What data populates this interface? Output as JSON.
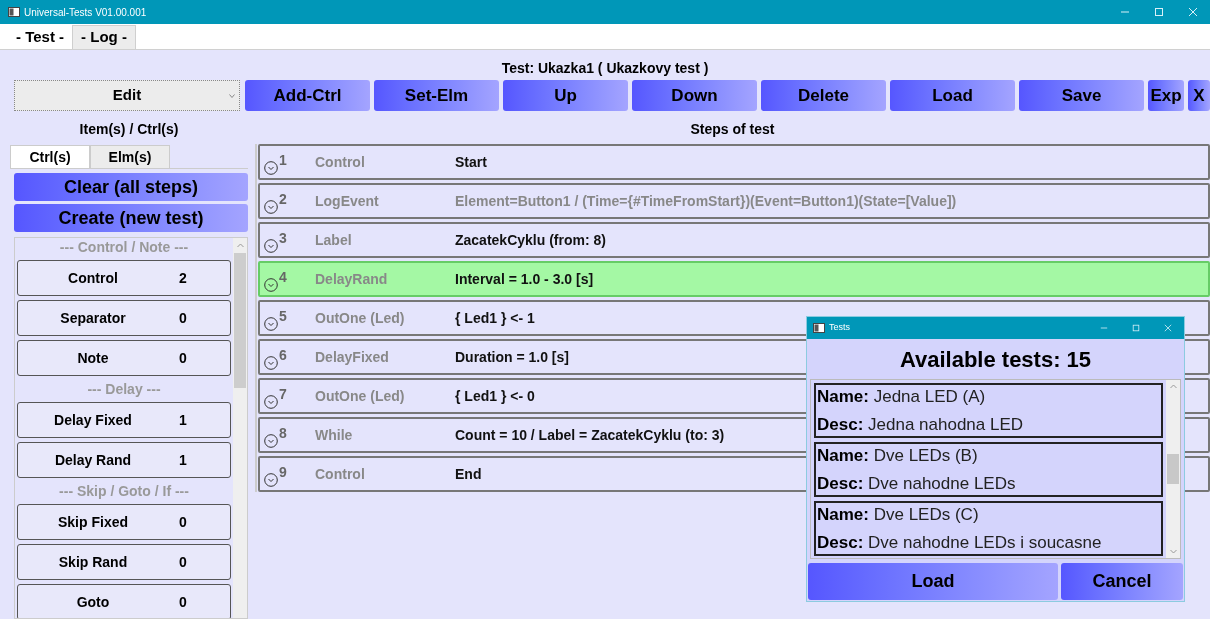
{
  "window": {
    "title": "Universal-Tests V01.00.001"
  },
  "main_tabs": [
    {
      "label": "- Test -",
      "selected": true
    },
    {
      "label": "- Log -",
      "selected": false
    }
  ],
  "test_title": "Test: Ukazka1 ( Ukazkovy test )",
  "mode_select": {
    "value": "Edit"
  },
  "toolbar": [
    "Add-Ctrl",
    "Set-Elm",
    "Up",
    "Down",
    "Delete",
    "Load",
    "Save",
    "Exp",
    "X"
  ],
  "sidebar": {
    "heading": "Item(s) / Ctrl(s)",
    "tabs": [
      {
        "label": "Ctrl(s)",
        "selected": true
      },
      {
        "label": "Elm(s)",
        "selected": false
      }
    ],
    "actions": [
      "Clear (all steps)",
      "Create (new test)"
    ],
    "items": [
      {
        "kind": "section",
        "label": "--- Control / Note ---"
      },
      {
        "kind": "item",
        "label": "Control",
        "count": "2"
      },
      {
        "kind": "item",
        "label": "Separator",
        "count": "0"
      },
      {
        "kind": "item",
        "label": "Note",
        "count": "0"
      },
      {
        "kind": "section",
        "label": "--- Delay ---"
      },
      {
        "kind": "item",
        "label": "Delay Fixed",
        "count": "1"
      },
      {
        "kind": "item",
        "label": "Delay Rand",
        "count": "1"
      },
      {
        "kind": "section",
        "label": "--- Skip / Goto / If ---"
      },
      {
        "kind": "item",
        "label": "Skip Fixed",
        "count": "0"
      },
      {
        "kind": "item",
        "label": "Skip Rand",
        "count": "0"
      },
      {
        "kind": "item",
        "label": "Goto",
        "count": "0"
      }
    ]
  },
  "steps": {
    "heading": "Steps of test",
    "rows": [
      {
        "number": "1",
        "type": "Control",
        "detail": "Start",
        "dimmed": false,
        "selected": false
      },
      {
        "number": "2",
        "type": "LogEvent",
        "detail": "Element=Button1 / (Time={#TimeFromStart})(Event=Button1)(State=[Value])",
        "dimmed": true,
        "selected": false
      },
      {
        "number": "3",
        "type": "Label",
        "detail": "ZacatekCyklu (from: 8)",
        "dimmed": false,
        "selected": false
      },
      {
        "number": "4",
        "type": "DelayRand",
        "detail": "Interval = 1.0 - 3.0 [s]",
        "dimmed": false,
        "selected": true
      },
      {
        "number": "5",
        "type": "OutOne (Led)",
        "detail": "{ Led1 } <- 1",
        "dimmed": false,
        "selected": false
      },
      {
        "number": "6",
        "type": "DelayFixed",
        "detail": "Duration = 1.0 [s]",
        "dimmed": false,
        "selected": false
      },
      {
        "number": "7",
        "type": "OutOne (Led)",
        "detail": "{ Led1 } <- 0",
        "dimmed": false,
        "selected": false
      },
      {
        "number": "8",
        "type": "While",
        "detail": "Count = 10 / Label = ZacatekCyklu (to: 3)",
        "dimmed": false,
        "selected": false
      },
      {
        "number": "9",
        "type": "Control",
        "detail": "End",
        "dimmed": false,
        "selected": false
      }
    ]
  },
  "dialog": {
    "title": "Tests",
    "heading": "Available tests: 15",
    "tests": [
      {
        "name_label": "Name:",
        "name": "Jedna LED (A)",
        "desc_label": "Desc:",
        "desc": "Jedna nahodna LED"
      },
      {
        "name_label": "Name:",
        "name": "Dve LEDs (B)",
        "desc_label": "Desc:",
        "desc": "Dve nahodne LEDs"
      },
      {
        "name_label": "Name:",
        "name": "Dve LEDs (C)",
        "desc_label": "Desc:",
        "desc": "Dve nahodne LEDs i soucasne"
      }
    ],
    "buttons": [
      "Load",
      "Cancel"
    ]
  }
}
